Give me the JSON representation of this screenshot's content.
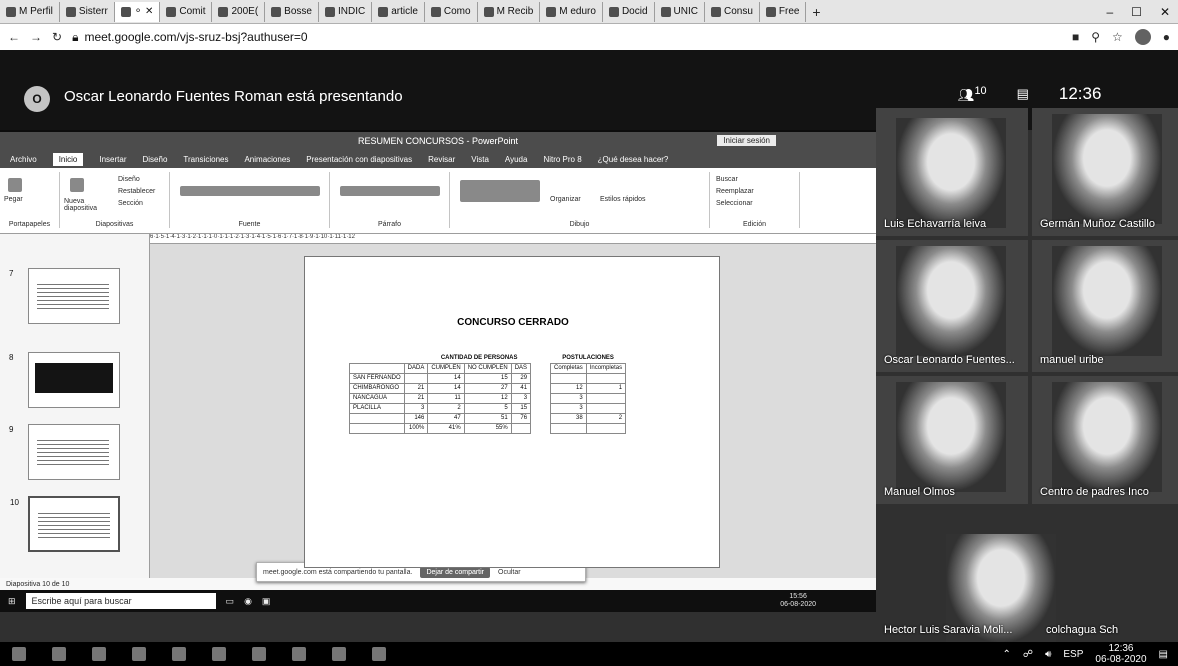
{
  "browser": {
    "tabs": [
      {
        "label": "M Perfil"
      },
      {
        "label": "Sisterr"
      },
      {
        "label": "⚬ ✕"
      },
      {
        "label": "Comit"
      },
      {
        "label": "200E("
      },
      {
        "label": "Bosse"
      },
      {
        "label": "INDIC"
      },
      {
        "label": "article"
      },
      {
        "label": "Como"
      },
      {
        "label": "M Recib"
      },
      {
        "label": "M eduro"
      },
      {
        "label": "Docid"
      },
      {
        "label": "UNIC"
      },
      {
        "label": "Consu"
      },
      {
        "label": "Free"
      }
    ],
    "new_tab": "+",
    "url": "meet.google.com/vjs-sruz-bsj?authuser=0",
    "win_minimize": "–",
    "win_restore": "☐",
    "win_close": "✕"
  },
  "meet": {
    "presenter_initial": "O",
    "presenting_text": "Oscar Leonardo Fuentes Roman está presentando",
    "participant_count": "10",
    "time": "12:36"
  },
  "powerpoint": {
    "title": "RESUMEN CONCURSOS - PowerPoint",
    "signin": "Iniciar sesión",
    "tabs": [
      "Archivo",
      "Inicio",
      "Insertar",
      "Diseño",
      "Transiciones",
      "Animaciones",
      "Presentación con diapositivas",
      "Revisar",
      "Vista",
      "Ayuda",
      "Nitro Pro 8",
      "¿Qué desea hacer?"
    ],
    "ribbon_groups": [
      "Portapapeles",
      "Diapositivas",
      "Fuente",
      "Párrafo",
      "Dibujo",
      "Edición"
    ],
    "ribbon_tools": [
      "Pegar",
      "Nueva diapositiva",
      "Diseño",
      "Restablecer",
      "Sección",
      "Organizar",
      "Estilos rápidos",
      "Buscar",
      "Reemplazar",
      "Seleccionar"
    ],
    "ruler": "6·1·5·1·4·1·3·1·2·1·1·1·0·1·1·1·2·1·3·1·4·1·5·1·6·1·7·1·8·1·9·1·10·1·11·1·12",
    "thumbs": [
      {
        "num": "7"
      },
      {
        "num": "8"
      },
      {
        "num": "9"
      },
      {
        "num": "10"
      }
    ],
    "status": "Diapositiva 10 de 10",
    "slide": {
      "title": "CONCURSO CERRADO",
      "group1": "CANTIDAD DE PERSONAS",
      "group2": "POSTULACIONES",
      "columns": [
        "",
        "DADA",
        "CUMPLEN",
        "NO CUMPLEN",
        "DAS",
        "",
        "Completas",
        "Incompletas"
      ],
      "rows": [
        [
          "SAN FERNANDO",
          "",
          "14",
          "15",
          "29",
          "",
          "",
          ""
        ],
        [
          "CHIMBARONGO",
          "21",
          "14",
          "27",
          "41",
          "",
          "12",
          "1"
        ],
        [
          "NANCAGUA",
          "21",
          "11",
          "12",
          "3",
          "",
          "3",
          ""
        ],
        [
          "PLACILLA",
          "3",
          "2",
          "5",
          "15",
          "",
          "3",
          ""
        ],
        [
          "",
          "146",
          "47",
          "51",
          "76",
          "",
          "38",
          "2"
        ],
        [
          "",
          "100%",
          "41%",
          "55%",
          "",
          "",
          "",
          ""
        ]
      ]
    },
    "share_notice": "meet.google.com está compartiendo tu pantalla.",
    "share_stop": "Dejar de compartir",
    "share_hide": "Ocultar",
    "inner_search": "Escribe aquí para buscar",
    "inner_time": "15:56",
    "inner_date": "06-08-2020"
  },
  "participants": [
    {
      "name": "Luis Echavarría leiva"
    },
    {
      "name": "Germán Muñoz Castillo"
    },
    {
      "name": "Oscar Leonardo Fuentes..."
    },
    {
      "name": "manuel uribe"
    },
    {
      "name": "Manuel Olmos"
    },
    {
      "name": "Centro de padres Inco"
    },
    {
      "name": "Hector Luis Saravia Moli..."
    },
    {
      "name": "colchagua Sch"
    }
  ],
  "taskbar": {
    "lang": "ESP",
    "time": "12:36",
    "date": "06-08-2020"
  }
}
